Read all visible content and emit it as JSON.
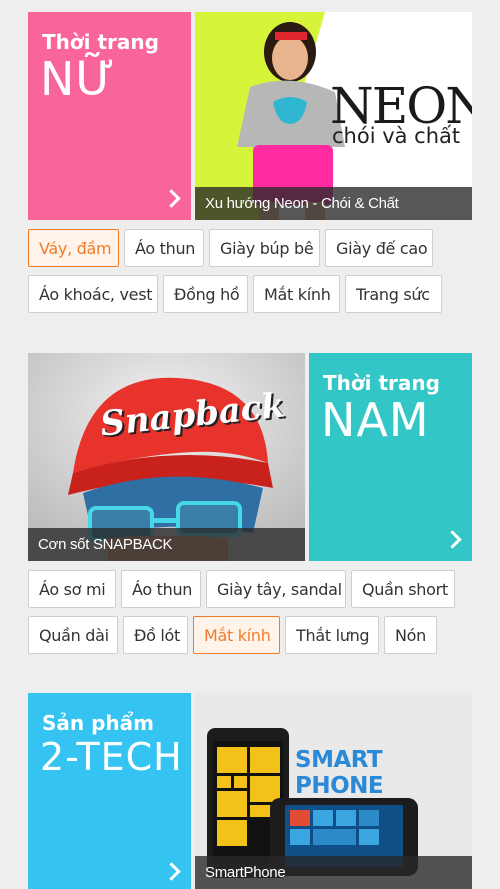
{
  "sections": [
    {
      "category": {
        "small": "Thời trang",
        "big": "NỮ",
        "color": "#f9659a"
      },
      "banner": {
        "caption": "Xu hướng Neon - Chói & Chất",
        "headline": "NEON",
        "subline": "chói và chất"
      },
      "tags": [
        "Váy, đầm",
        "Áo thun",
        "Giày búp bê",
        "Giày đế cao",
        "Áo khoác, vest",
        "Đồng hồ",
        "Mắt kính",
        "Trang sức"
      ],
      "active_tag": "Váy, đầm"
    },
    {
      "category": {
        "small": "Thời trang",
        "big": "NAM",
        "color": "#33c6c6"
      },
      "banner": {
        "caption": "Cơn sốt SNAPBACK",
        "headline": "Snapback"
      },
      "tags": [
        "Áo sơ mi",
        "Áo thun",
        "Giày tây, sandal",
        "Quần short",
        "Quần dài",
        "Đồ lót",
        "Mắt kính",
        "Thắt lưng",
        "Nón"
      ],
      "active_tag": "Mắt kính"
    },
    {
      "category": {
        "small": "Sản phẩm",
        "big": "2-TECH",
        "color": "#35c3f2"
      },
      "banner": {
        "caption": "SmartPhone",
        "headline": "SMART PHONE"
      }
    }
  ],
  "colors": {
    "accent": "#f07c2a",
    "background": "#eeeeef"
  }
}
